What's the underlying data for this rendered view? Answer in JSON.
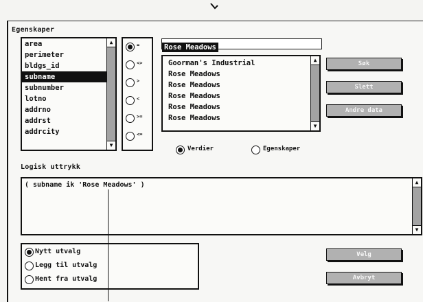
{
  "section_title": "Egenskaper",
  "fields": {
    "items": [
      "area",
      "perimeter",
      "bldgs_id",
      "subname",
      "subnumber",
      "lotno",
      "addrno",
      "addrst",
      "addrcity"
    ],
    "selected_index": 3
  },
  "operators": {
    "options": [
      "=",
      "<>",
      ">",
      "<",
      ">=",
      "<="
    ],
    "selected_index": 0
  },
  "value_input": {
    "value": "Rose Meadows"
  },
  "values": {
    "items": [
      "Goorman's Industrial",
      "Rose Meadows",
      "Rose Meadows",
      "Rose Meadows",
      "Rose Meadows",
      "Rose Meadows"
    ]
  },
  "buttons": {
    "search": "Søk",
    "clear": "Slett",
    "load": "Andre data",
    "choose": "Velg",
    "cancel": "Avbryt"
  },
  "mode": {
    "values_label": "Verdier",
    "properties_label": "Egenskaper",
    "selected": "values"
  },
  "expression": {
    "label": "Logisk uttrykk",
    "text": "( subname ik 'Rose Meadows' )"
  },
  "selection": {
    "options": [
      "Nytt utvalg",
      "Legg til utvalg",
      "Hent fra utvalg"
    ],
    "selected_index": 0
  }
}
